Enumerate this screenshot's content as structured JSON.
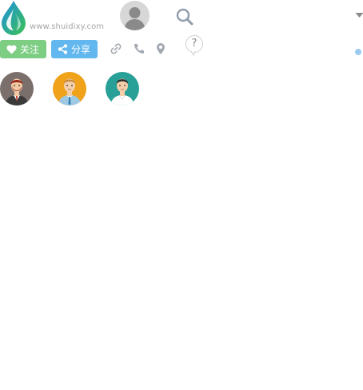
{
  "header": {
    "site_url": "www.shuidixy.com",
    "logo_colors": {
      "blue": "#1e8fe1",
      "green": "#3cc251"
    },
    "icons": {
      "search": "search-icon",
      "dropdown": "chevron-down-icon",
      "user_avatar": "user-avatar-placeholder"
    }
  },
  "actions": {
    "follow_label": "关注",
    "share_label": "分享",
    "icons": [
      "heart-icon",
      "share-icon",
      "link-icon",
      "phone-icon",
      "location-pin-icon"
    ],
    "help_label": "?",
    "colors": {
      "follow": "#7dcd83",
      "share": "#62b7ee"
    }
  },
  "status_dot_color": "#9ccbef",
  "people": [
    {
      "id": "person-1",
      "bg": "#7b6f6c"
    },
    {
      "id": "person-2",
      "bg": "#efa21a"
    },
    {
      "id": "person-3",
      "bg": "#289f97"
    }
  ]
}
